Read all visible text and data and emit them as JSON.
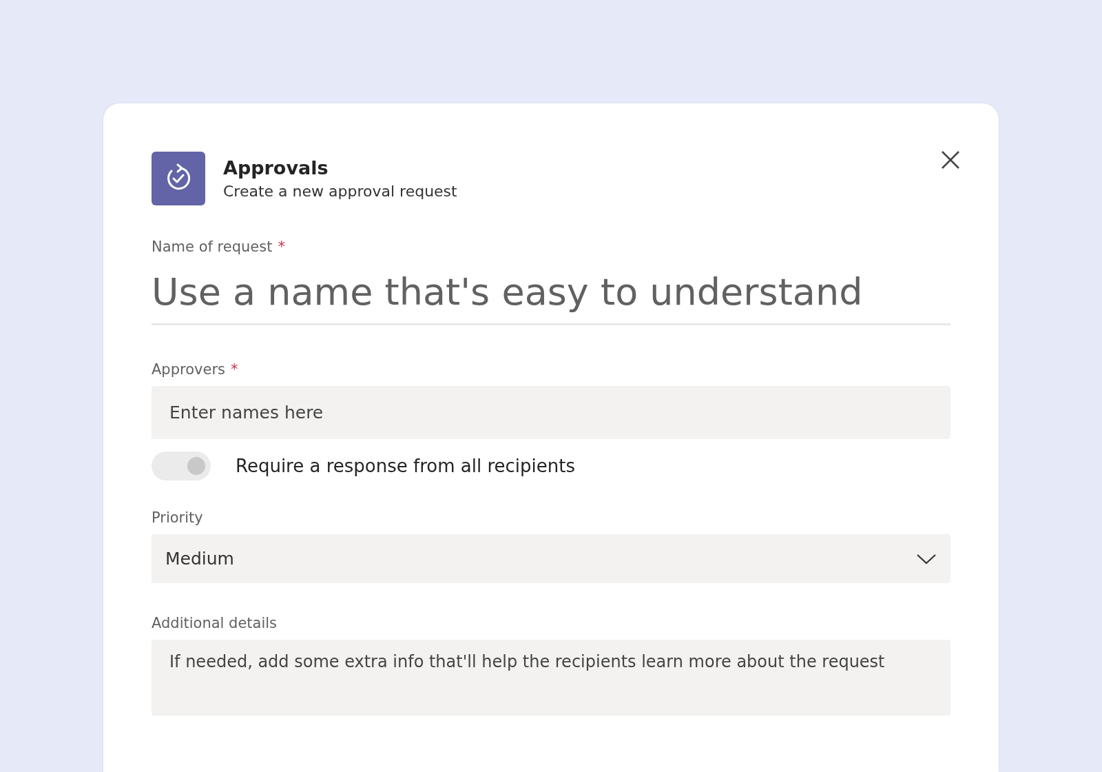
{
  "app": {
    "name": "Approvals",
    "subtitle": "Create a new approval request"
  },
  "fields": [
    {
      "kind": "title",
      "label": "Name of request",
      "required_mark": "*",
      "placeholder": "Use a name that's easy to understand"
    },
    {
      "kind": "people",
      "label": "Approvers",
      "required_mark": "*",
      "placeholder": "Enter names here"
    },
    {
      "kind": "toggle",
      "label": "Require a response from all recipients",
      "on": true,
      "disabled": true
    },
    {
      "kind": "select",
      "label": "Priority",
      "value": "Medium"
    },
    {
      "kind": "textarea",
      "label": "Additional details",
      "placeholder": "If needed, add some extra info that'll help the recipients learn more about the request"
    }
  ]
}
